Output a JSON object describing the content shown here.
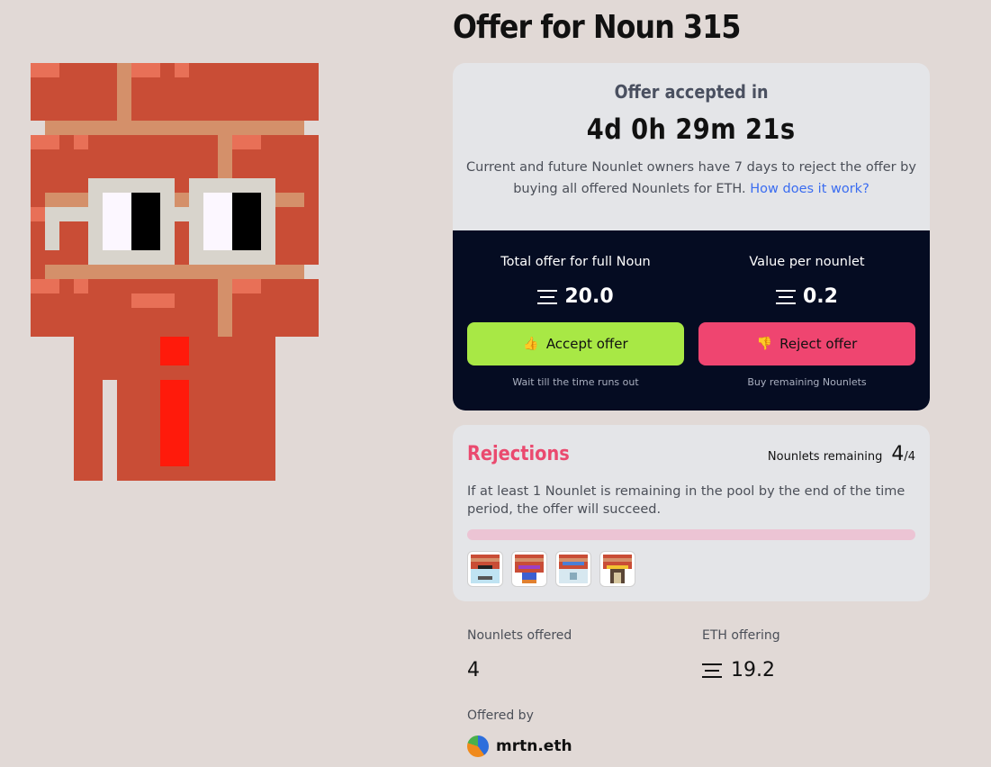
{
  "page": {
    "title": "Offer for Noun 315"
  },
  "countdown": {
    "label": "Offer accepted in",
    "value": "4d 0h 29m 21s",
    "description": "Current and future Nounlet owners have 7 days to reject the offer by buying all offered Nounlets for ETH.",
    "link": "How does it work?"
  },
  "offer": {
    "total_label": "Total offer for full Noun",
    "total_value": "20.0",
    "per_label": "Value per nounlet",
    "per_value": "0.2",
    "accept_label": "Accept offer",
    "accept_hint": "Wait till the time runs out",
    "reject_label": "Reject offer",
    "reject_hint": "Buy remaining Nounlets",
    "eth_icon": "eth-icon"
  },
  "rejections": {
    "title": "Rejections",
    "remaining_label": "Nounlets remaining",
    "remaining_value": "4",
    "remaining_total": "/4",
    "remaining_fraction": 1.0,
    "description": "If at least 1 Nounlet is remaining in the pool by the end of the time period, the offer will succeed."
  },
  "stats": {
    "offered_label": "Nounlets offered",
    "offered_value": "4",
    "eth_label": "ETH offering",
    "eth_value": "19.2",
    "offered_by_label": "Offered by",
    "offered_by_name": "mrtn.eth"
  },
  "colors": {
    "background": "#e1d9d6",
    "accept": "#a8e845",
    "reject": "#ef4570",
    "dark_panel": "#050c22",
    "rejections_title": "#ea4a6f"
  }
}
